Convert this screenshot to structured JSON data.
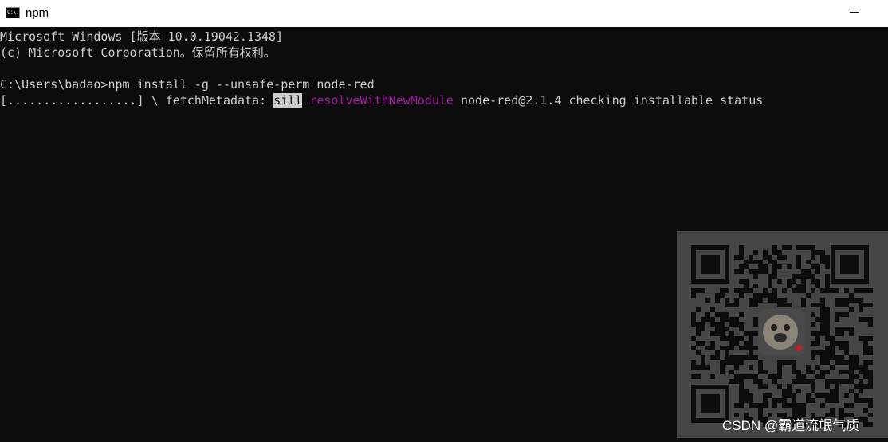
{
  "window": {
    "title": "npm",
    "icon": "cmd-icon",
    "icon_text": "C:\\."
  },
  "console": {
    "line1": "Microsoft Windows [版本 10.0.19042.1348]",
    "line2": "(c) Microsoft Corporation。保留所有权利。",
    "prompt": "C:\\Users\\badao>npm install -g --unsafe-perm node-red",
    "progress_prefix": "[..................] \\ fetchMetadata: ",
    "progress_sill": "sill",
    "progress_module": "resolveWithNewModule",
    "progress_rest": " node-red@2.1.4 checking installable status",
    "colors": {
      "background": "#0c0c0c",
      "text": "#cccccc",
      "highlight_bg": "#cccccc",
      "magenta": "#a61aa6"
    }
  },
  "overlay": {
    "watermark": "CSDN @霸道流氓气质",
    "qr_icon": "qr-code-icon"
  }
}
